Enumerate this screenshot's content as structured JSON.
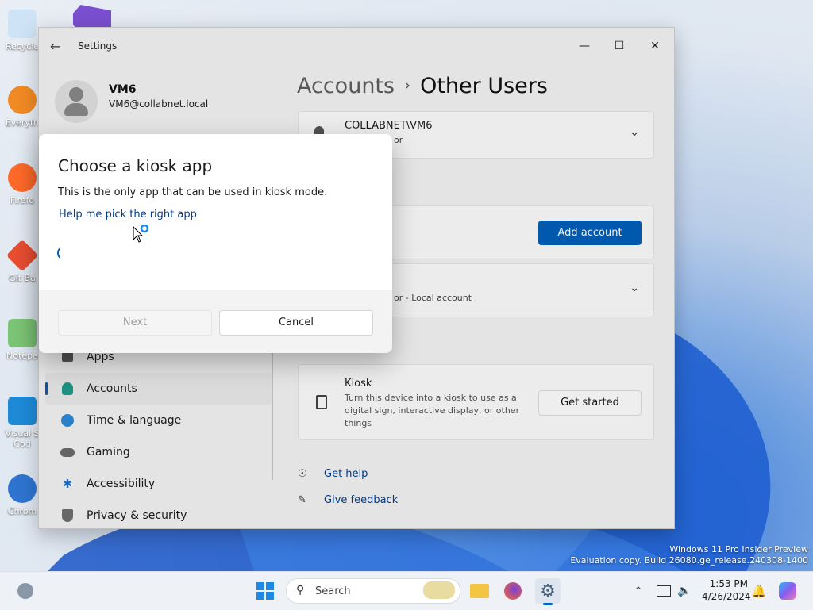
{
  "desktop": {
    "icons": [
      {
        "label": "Recycle"
      },
      {
        "label": "Everyth"
      },
      {
        "label": "Firefo"
      },
      {
        "label": "Git Ba"
      },
      {
        "label": "Notepa"
      },
      {
        "label": "Visual S Cod"
      },
      {
        "label": "Chrom"
      }
    ],
    "watermark_line1": "Windows 11 Pro Insider Preview",
    "watermark_line2": "Evaluation copy. Build 26080.ge_release.240308-1400"
  },
  "window": {
    "title": "Settings",
    "back_icon": "arrow-left-icon",
    "user_name": "VM6",
    "user_email": "VM6@collabnet.local",
    "breadcrumb_parent": "Accounts",
    "breadcrumb_separator": "›",
    "breadcrumb_current": "Other Users"
  },
  "nav": [
    {
      "label": "Apps",
      "icon": "apps-icon"
    },
    {
      "label": "Accounts",
      "icon": "accounts-icon",
      "active": true
    },
    {
      "label": "Time & language",
      "icon": "globe-icon"
    },
    {
      "label": "Gaming",
      "icon": "gamepad-icon"
    },
    {
      "label": "Accessibility",
      "icon": "accessibility-icon"
    },
    {
      "label": "Privacy & security",
      "icon": "shield-icon"
    }
  ],
  "content": {
    "user_card_name": "COLLABNET\\VM6",
    "user_card_sub": "or",
    "add_account_label": "Add account",
    "local_account_sub": "or - Local account",
    "kiosk_title": "Kiosk",
    "kiosk_desc": "Turn this device into a kiosk to use as a digital sign, interactive display, or other things",
    "get_started_label": "Get started",
    "get_help_label": "Get help",
    "give_feedback_label": "Give feedback"
  },
  "dialog": {
    "title": "Choose a kiosk app",
    "text": "This is the only app that can be used in kiosk mode.",
    "link": "Help me pick the right app",
    "next_label": "Next",
    "cancel_label": "Cancel"
  },
  "taskbar": {
    "search_placeholder": "Search",
    "time": "1:53 PM",
    "date": "4/26/2024"
  },
  "colors": {
    "accent": "#005fb8",
    "link": "#003e92"
  }
}
